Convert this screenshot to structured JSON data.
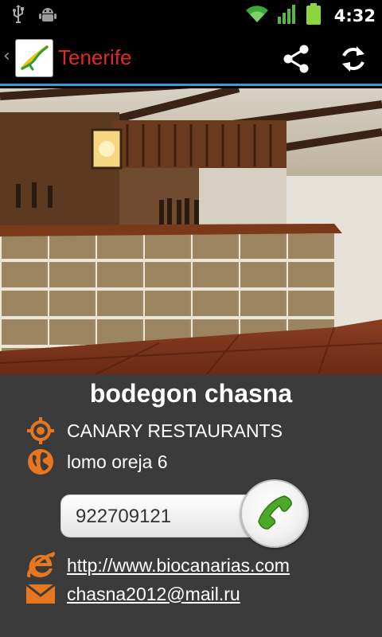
{
  "status_bar": {
    "time": "4:32",
    "icons": [
      "usb-icon",
      "android-debug-icon",
      "wifi-icon",
      "signal-icon",
      "battery-icon"
    ]
  },
  "action_bar": {
    "title": "Tenerife",
    "title_color": "#e02a2a",
    "accent": "#2e9fd7",
    "actions": [
      "share-icon",
      "refresh-icon"
    ]
  },
  "place": {
    "name": "bodegon chasna",
    "category": "CANARY RESTAURANTS",
    "address": "lomo oreja 6",
    "phone": "922709121",
    "website": "http://www.biocanarias.com",
    "email": "chasna2012@mail.ru"
  },
  "colors": {
    "icon_orange": "#e8761f",
    "call_green": "#4ea82a",
    "panel_bg": "#3b3b3b"
  }
}
